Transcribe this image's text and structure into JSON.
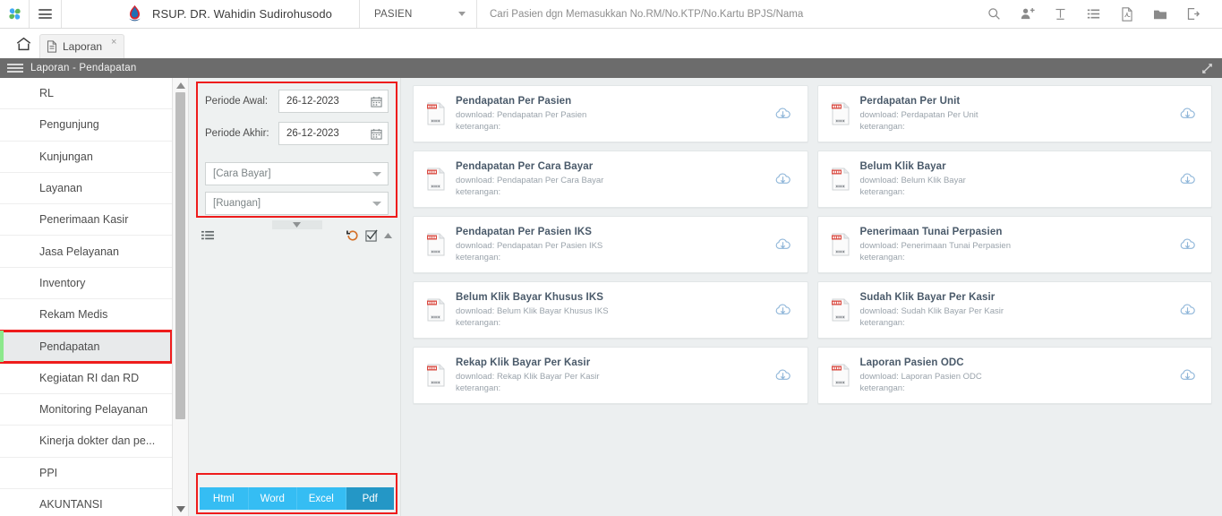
{
  "topbar": {
    "logo_icon": "pinwheel-logo",
    "menu_icon": "hamburger-icon",
    "hospital_icon": "hospital-flame-logo",
    "hospital_name": "RSUP. DR. Wahidin Sudirohusodo",
    "module_select": "PASIEN",
    "search_placeholder": "Cari Pasien dgn Memasukkan No.RM/No.KTP/No.Kartu BPJS/Nama",
    "search_value": "",
    "icons": [
      {
        "name": "search-icon"
      },
      {
        "name": "add-user-icon"
      },
      {
        "name": "text-tool-icon"
      },
      {
        "name": "list-icon"
      },
      {
        "name": "pdf-file-icon"
      },
      {
        "name": "folder-icon"
      },
      {
        "name": "logout-icon"
      }
    ]
  },
  "tabbar": {
    "home_icon": "home-icon",
    "tabs": [
      {
        "label": "Laporan",
        "icon": "document-icon",
        "close": "×",
        "active": true
      }
    ]
  },
  "breadcrumb": {
    "menu_icon": "hamburger-icon",
    "text": "Laporan - Pendapatan",
    "expand_icon": "expand-arrow-icon"
  },
  "sidebar": {
    "items": [
      {
        "label": "RL",
        "active": false
      },
      {
        "label": "Pengunjung",
        "active": false
      },
      {
        "label": "Kunjungan",
        "active": false
      },
      {
        "label": "Layanan",
        "active": false
      },
      {
        "label": "Penerimaan Kasir",
        "active": false
      },
      {
        "label": "Jasa Pelayanan",
        "active": false
      },
      {
        "label": "Inventory",
        "active": false
      },
      {
        "label": "Rekam Medis",
        "active": false
      },
      {
        "label": "Pendapatan",
        "active": true
      },
      {
        "label": "Kegiatan RI dan RD",
        "active": false
      },
      {
        "label": "Monitoring Pelayanan",
        "active": false
      },
      {
        "label": "Kinerja dokter dan pe...",
        "active": false
      },
      {
        "label": "PPI",
        "active": false
      },
      {
        "label": "AKUNTANSI",
        "active": false
      }
    ],
    "scroll_up_icon": "scroll-up-arrow-icon",
    "scroll_down_icon": "scroll-down-arrow-icon"
  },
  "filters": {
    "periode_awal_label": "Periode Awal:",
    "periode_awal_value": "26-12-2023",
    "periode_akhir_label": "Periode Akhir:",
    "periode_akhir_value": "26-12-2023",
    "calendar_icon": "calendar-icon",
    "cara_bayar_placeholder": "[Cara Bayar]",
    "ruangan_placeholder": "[Ruangan]",
    "expand_handle_icon": "chevron-down-icon",
    "toolbar": {
      "list_icon": "list-lines-icon",
      "reset_icon": "reset-history-icon",
      "check_icon": "checkbox-checked-icon",
      "collapse_icon": "chevron-up-icon"
    }
  },
  "export": {
    "buttons": [
      {
        "label": "Html",
        "selected": false
      },
      {
        "label": "Word",
        "selected": false
      },
      {
        "label": "Excel",
        "selected": false
      },
      {
        "label": "Pdf",
        "selected": true
      }
    ]
  },
  "reports": {
    "download_prefix": "download: ",
    "keterangan_label": "keterangan:",
    "left_column": [
      {
        "title": "Pendapatan Per Pasien",
        "download": "download: Pendapatan Per Pasien",
        "keterangan": "keterangan:"
      },
      {
        "title": "Pendapatan Per Cara Bayar",
        "download": "download: Pendapatan Per Cara Bayar",
        "keterangan": "keterangan:"
      },
      {
        "title": "Pendapatan Per Pasien IKS",
        "download": "download: Pendapatan Per Pasien IKS",
        "keterangan": "keterangan:"
      },
      {
        "title": "Belum Klik Bayar Khusus IKS",
        "download": "download: Belum Klik Bayar Khusus IKS",
        "keterangan": "keterangan:"
      },
      {
        "title": "Rekap Klik Bayar Per Kasir",
        "download": "download: Rekap Klik Bayar Per Kasir",
        "keterangan": "keterangan:"
      }
    ],
    "right_column": [
      {
        "title": "Perdapatan Per Unit",
        "download": "download: Perdapatan Per Unit",
        "keterangan": "keterangan:"
      },
      {
        "title": "Belum Klik Bayar",
        "download": "download: Belum Klik Bayar",
        "keterangan": "keterangan:"
      },
      {
        "title": "Penerimaan Tunai Perpasien",
        "download": "download: Penerimaan Tunai Perpasien",
        "keterangan": "keterangan:"
      },
      {
        "title": "Sudah Klik Bayar Per Kasir",
        "download": "download: Sudah Klik Bayar Per Kasir",
        "keterangan": "keterangan:"
      },
      {
        "title": "Laporan Pasien ODC",
        "download": "download: Laporan Pasien ODC",
        "keterangan": "keterangan:"
      }
    ],
    "card_icon": "report-document-icon",
    "download_icon": "cloud-download-icon"
  },
  "colors": {
    "accent_blue": "#35bdf3",
    "accent_blue_selected": "#2497c6",
    "highlight_red": "#ee1c1c",
    "sidebar_active": "#e8eaeb",
    "sidebar_active_bar": "#8ce88c",
    "crumb_bar": "#6c6c6c",
    "card_title": "#4a5a6a",
    "page_bg": "#eceff0"
  }
}
